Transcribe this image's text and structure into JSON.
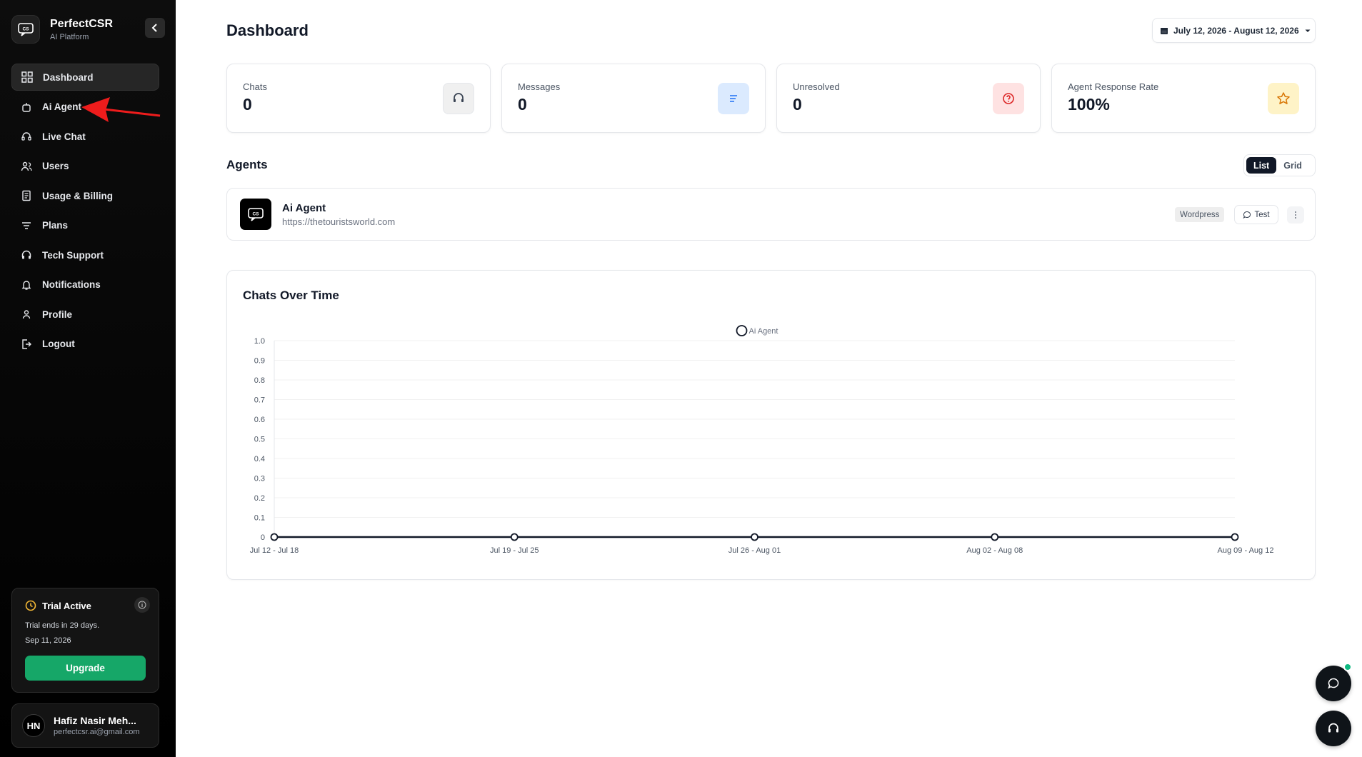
{
  "brand": {
    "name": "PerfectCSR",
    "subtitle": "AI Platform"
  },
  "sidebar": {
    "items": [
      {
        "label": "Dashboard",
        "icon": "grid-icon",
        "active": true
      },
      {
        "label": "Ai Agent",
        "icon": "robot-icon"
      },
      {
        "label": "Live Chat",
        "icon": "headset-icon"
      },
      {
        "label": "Users",
        "icon": "users-icon"
      },
      {
        "label": "Usage & Billing",
        "icon": "receipt-icon"
      },
      {
        "label": "Plans",
        "icon": "filter-icon"
      },
      {
        "label": "Tech Support",
        "icon": "headphones-icon"
      },
      {
        "label": "Notifications",
        "icon": "bell-icon"
      },
      {
        "label": "Profile",
        "icon": "user-icon"
      },
      {
        "label": "Logout",
        "icon": "logout-icon"
      }
    ]
  },
  "trial": {
    "title": "Trial Active",
    "ends": "Trial ends in 29 days.",
    "date": "Sep 11, 2026",
    "upgrade_label": "Upgrade"
  },
  "user": {
    "initials": "HN",
    "name": "Hafiz Nasir Meh...",
    "email": "perfectcsr.ai@gmail.com"
  },
  "header": {
    "title": "Dashboard",
    "date_range": "July 12, 2026 - August 12, 2026"
  },
  "stats": [
    {
      "label": "Chats",
      "value": "0",
      "icon": "chat-bubble-icon",
      "color": "#f3f4f6"
    },
    {
      "label": "Messages",
      "value": "0",
      "icon": "lines-icon",
      "color": "#dbeafe"
    },
    {
      "label": "Unresolved",
      "value": "0",
      "icon": "question-circle-icon",
      "color": "#fee2e2"
    },
    {
      "label": "Agent Response Rate",
      "value": "100%",
      "icon": "star-icon",
      "color": "#fef3c7"
    }
  ],
  "agents": {
    "title": "Agents",
    "view_list": "List",
    "view_grid": "Grid",
    "items": [
      {
        "name": "Ai Agent",
        "url": "https://thetouristsworld.com",
        "platform": "Wordpress",
        "test_label": "Test"
      }
    ]
  },
  "chart_data": {
    "type": "line",
    "title": "Chats Over Time",
    "categories": [
      "Jul 12 - Jul 18",
      "Jul 19 - Jul 25",
      "Jul 26 - Aug 01",
      "Aug 02 - Aug 08",
      "Aug 09 - Aug 12"
    ],
    "series": [
      {
        "name": "Ai Agent",
        "values": [
          0,
          0,
          0,
          0,
          0
        ]
      }
    ],
    "ylim": [
      0,
      1
    ],
    "yticks": [
      "1.0",
      "0.9",
      "0.8",
      "0.7",
      "0.6",
      "0.5",
      "0.4",
      "0.3",
      "0.2",
      "0.1",
      "0"
    ],
    "grid": true,
    "legend": "top-center"
  }
}
